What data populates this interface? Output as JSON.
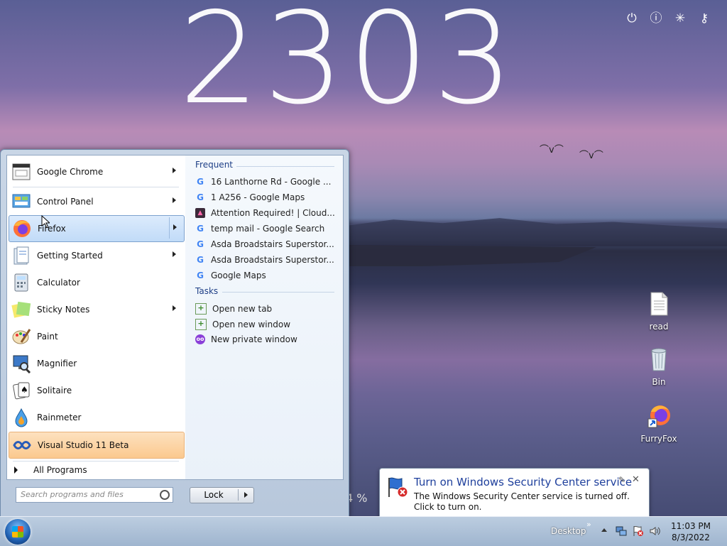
{
  "clock": {
    "digits": "2303"
  },
  "top_icons": [
    "power-icon",
    "info-icon",
    "refresh-icon",
    "settings-key-icon"
  ],
  "desktop_icons": [
    {
      "label": "read",
      "icon": "text-file-icon"
    },
    {
      "label": "Bin",
      "icon": "recycle-bin-icon"
    },
    {
      "label": "FurryFox",
      "icon": "firefox-shortcut-icon"
    }
  ],
  "start_menu": {
    "programs": [
      {
        "label": "Google Chrome",
        "icon": "chrome-icon",
        "has_arrow": true
      },
      {
        "label": "Control Panel",
        "icon": "control-panel-icon",
        "has_arrow": true
      },
      {
        "label": "Firefox",
        "icon": "firefox-icon",
        "has_arrow": true
      },
      {
        "label": "Getting Started",
        "icon": "getting-started-icon",
        "has_arrow": true
      },
      {
        "label": "Calculator",
        "icon": "calculator-icon",
        "has_arrow": false
      },
      {
        "label": "Sticky Notes",
        "icon": "sticky-notes-icon",
        "has_arrow": true
      },
      {
        "label": "Paint",
        "icon": "paint-icon",
        "has_arrow": false
      },
      {
        "label": "Magnifier",
        "icon": "magnifier-icon",
        "has_arrow": false
      },
      {
        "label": "Solitaire",
        "icon": "solitaire-icon",
        "has_arrow": false
      },
      {
        "label": "Rainmeter",
        "icon": "rainmeter-icon",
        "has_arrow": false
      },
      {
        "label": "Visual Studio 11 Beta",
        "icon": "visual-studio-icon",
        "has_arrow": false
      }
    ],
    "all_programs": "All Programs",
    "search_placeholder": "Search programs and files",
    "lock_label": "Lock",
    "jumplist": {
      "frequent_title": "Frequent",
      "frequent": [
        {
          "label": "16 Lanthorne Rd - Google ...",
          "icon": "google-icon"
        },
        {
          "label": "1 A256 - Google Maps",
          "icon": "google-icon"
        },
        {
          "label": "Attention Required! | Cloud...",
          "icon": "cloudflare-icon"
        },
        {
          "label": "temp mail - Google Search",
          "icon": "google-icon"
        },
        {
          "label": "Asda Broadstairs Superstor...",
          "icon": "google-icon"
        },
        {
          "label": "Asda Broadstairs Superstor...",
          "icon": "google-icon"
        },
        {
          "label": "Google Maps",
          "icon": "google-icon"
        }
      ],
      "tasks_title": "Tasks",
      "tasks": [
        {
          "label": "Open new tab",
          "icon": "new-tab-icon"
        },
        {
          "label": "Open new window",
          "icon": "new-window-icon"
        },
        {
          "label": "New private window",
          "icon": "private-window-icon"
        }
      ]
    }
  },
  "notification": {
    "title": "Turn on Windows Security Center service",
    "text": "The Windows Security Center service is turned off. Click to turn on.",
    "icon": "security-center-flag-icon"
  },
  "desktop_widget_percent": "4 %",
  "taskbar": {
    "desktop_label": "Desktop",
    "chevron": "»",
    "time": "11:03 PM",
    "date": "8/3/2022"
  },
  "colors": {
    "accent_blue": "#1e3f86",
    "highlight": "#c1dbf8",
    "vs_highlight": "#fbc98e"
  }
}
